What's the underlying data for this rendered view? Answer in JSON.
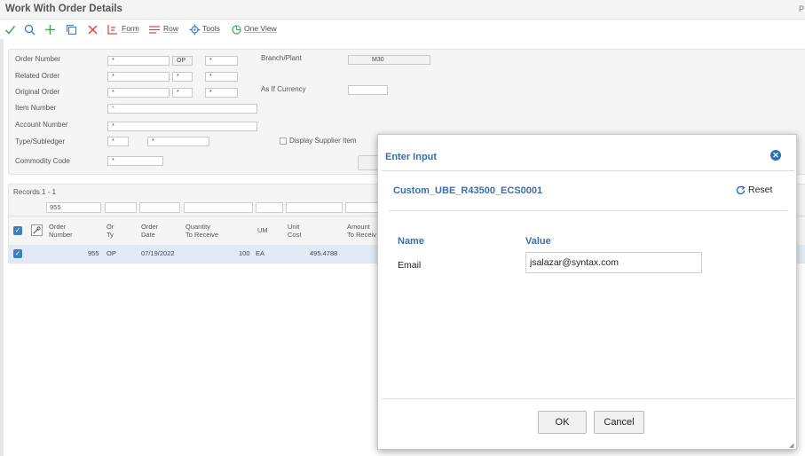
{
  "window": {
    "title": "Work With Order Details",
    "right_edge_text": "P"
  },
  "toolbar": {
    "icons": [
      "checkmark-icon",
      "search-icon",
      "plus-icon",
      "copy-icon",
      "close-icon"
    ],
    "form_label": "Form",
    "row_label": "Row",
    "tools_label": "Tools",
    "oneview_label": "One View"
  },
  "form": {
    "order_number_label": "Order Number",
    "order_number_value": "*",
    "order_type_value": "OP",
    "order_company_value": "*",
    "related_order_label": "Related Order",
    "related_order_value": "*",
    "related_type_value": "*",
    "related_company_value": "*",
    "original_order_label": "Original Order",
    "original_order_value": "*",
    "original_type_value": "*",
    "original_company_value": "*",
    "item_number_label": "Item Number",
    "item_number_value": "*",
    "account_number_label": "Account Number",
    "account_number_value": "*",
    "type_subledger_label": "Type/Subledger",
    "type_value": "*",
    "subledger_value": "*",
    "commodity_code_label": "Commodity Code",
    "commodity_code_value": "*",
    "branch_plant_label": "Branch/Plant",
    "branch_plant_value": "M30",
    "as_if_currency_label": "As If Currency",
    "as_if_currency_value": "",
    "display_supplier_item_label": "Display Supplier Item"
  },
  "grid": {
    "records_label": "Records 1 - 1",
    "qbe_order_number": "955",
    "columns": [
      {
        "line1": "Order",
        "line2": "Number"
      },
      {
        "line1": "Or",
        "line2": "Ty"
      },
      {
        "line1": "Order",
        "line2": "Date"
      },
      {
        "line1": "Quantity",
        "line2": "To Receive"
      },
      {
        "line1": "UM",
        "line2": ""
      },
      {
        "line1": "Unit",
        "line2": "Cost"
      },
      {
        "line1": "Amount",
        "line2": "To Receiv"
      }
    ],
    "rows": [
      {
        "order_number": "955",
        "or_ty": "OP",
        "order_date": "07/19/2022",
        "quantity": "100",
        "um": "EA",
        "unit_cost": "495.4788"
      }
    ]
  },
  "dialog": {
    "title": "Enter Input",
    "ube_name": "Custom_UBE_R43500_ECS0001",
    "reset_label": "Reset",
    "name_header": "Name",
    "value_header": "Value",
    "field_label": "Email",
    "field_value": "jsalazar@syntax.com",
    "ok_label": "OK",
    "cancel_label": "Cancel"
  },
  "colors": {
    "accent": "#3b6fa8",
    "check_blue": "#3a7fc1",
    "toolbar_red": "#e0443a",
    "toolbar_green": "#3cae5b"
  }
}
